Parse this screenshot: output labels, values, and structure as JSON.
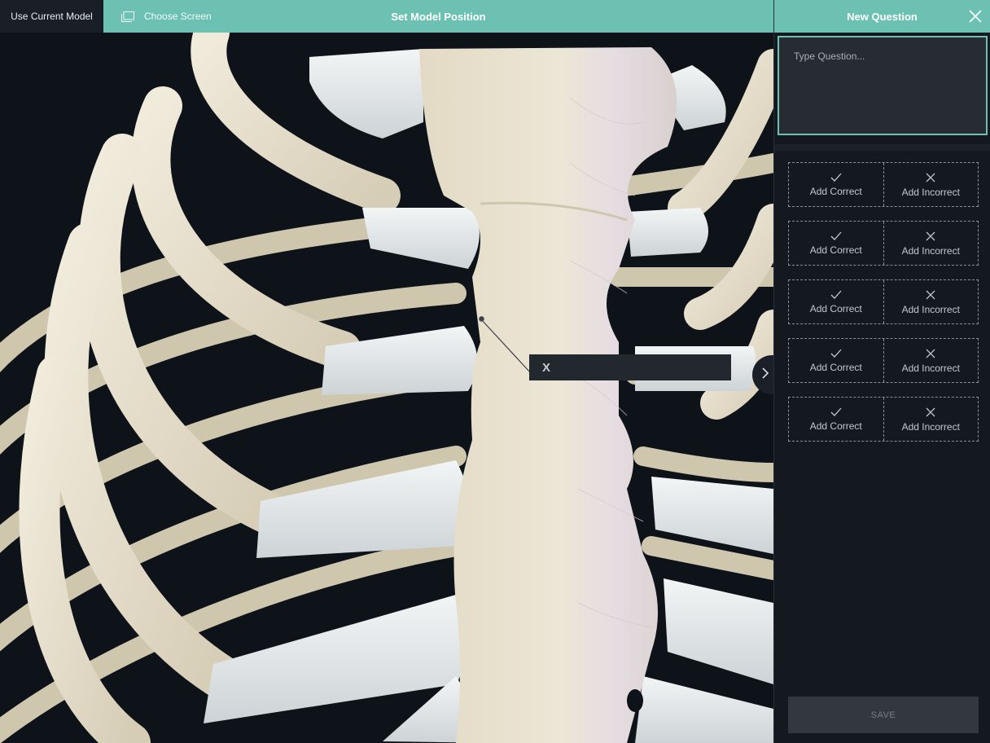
{
  "toolbar": {
    "use_current_model": "Use Current Model",
    "choose_screen": "Choose Screen",
    "title": "Set Model Position"
  },
  "label_tag": {
    "text": "X"
  },
  "panel": {
    "title": "New Question",
    "question_placeholder": "Type Question...",
    "answer_rows": [
      {
        "correct_label": "Add Correct",
        "incorrect_label": "Add Incorrect"
      },
      {
        "correct_label": "Add Correct",
        "incorrect_label": "Add Incorrect"
      },
      {
        "correct_label": "Add Correct",
        "incorrect_label": "Add Incorrect"
      },
      {
        "correct_label": "Add Correct",
        "incorrect_label": "Add Incorrect"
      },
      {
        "correct_label": "Add Correct",
        "incorrect_label": "Add Incorrect"
      }
    ],
    "save_label": "SAVE"
  },
  "icons": {
    "choose_screen": "screen-icon",
    "close": "close-icon",
    "correct": "check-icon",
    "incorrect": "x-icon",
    "expand": "chevron-right-icon"
  },
  "colors": {
    "accent": "#6cc1b2",
    "panel_bg": "#14191f",
    "viewport_bg": "#0e1319",
    "bone": "#e6dfcc",
    "cartilage": "#dfe3e5"
  }
}
